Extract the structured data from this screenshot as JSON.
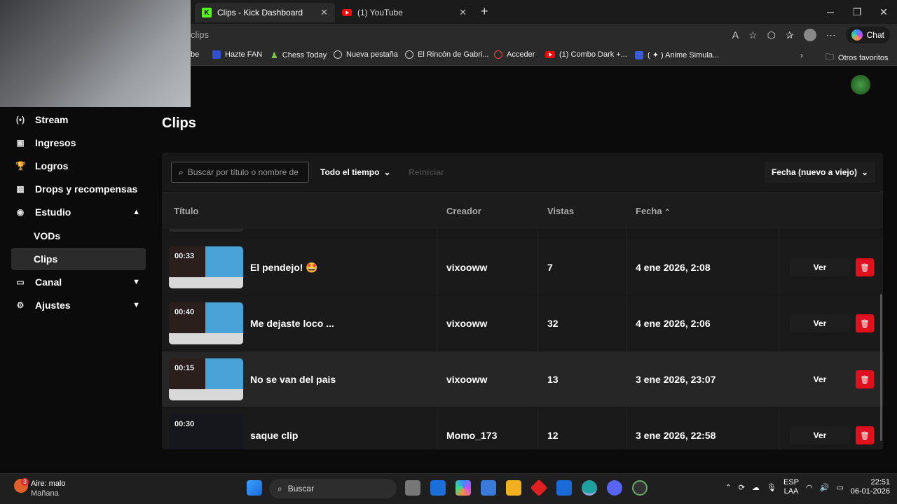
{
  "browser": {
    "tabs": [
      {
        "label": "Clips - Kick Dashboard"
      },
      {
        "label": "(1) YouTube"
      }
    ],
    "url": "clips",
    "chat_label": "Chat",
    "bookmarks": [
      {
        "label": "be"
      },
      {
        "label": "Hazte FAN"
      },
      {
        "label": "Chess Today"
      },
      {
        "label": "Nueva pestaña"
      },
      {
        "label": "El Rincón de Gabri..."
      },
      {
        "label": "Acceder"
      },
      {
        "label": "(1) Combo Dark +..."
      },
      {
        "label": "( ✦ ) Anime Simula..."
      }
    ],
    "other_favorites": "Otros favoritos"
  },
  "sidebar": {
    "items": [
      {
        "label": "Stream",
        "icon": "broadcast-icon"
      },
      {
        "label": "Ingresos",
        "icon": "wallet-icon"
      },
      {
        "label": "Logros",
        "icon": "trophy-icon"
      },
      {
        "label": "Drops y recompensas",
        "icon": "gift-icon"
      },
      {
        "label": "Estudio",
        "icon": "studio-icon"
      },
      {
        "label": "VODs"
      },
      {
        "label": "Clips"
      },
      {
        "label": "Canal",
        "icon": "channel-icon"
      },
      {
        "label": "Ajustes",
        "icon": "gear-icon"
      }
    ]
  },
  "main": {
    "title": "Clips",
    "search_placeholder": "Buscar por título o nombre de",
    "time_filter": "Todo el tiempo",
    "reset": "Reiniciar",
    "sort": "Fecha (nuevo a viejo)",
    "columns": {
      "title": "Título",
      "creator": "Creador",
      "views": "Vistas",
      "date": "Fecha"
    },
    "rows": [
      {
        "duration": "00:33",
        "title": "El pendejo! 🤩",
        "creator": "vixooww",
        "views": "7",
        "date": "4 ene 2026, 2:08",
        "view_label": "Ver"
      },
      {
        "duration": "00:40",
        "title": "Me dejaste loco ...",
        "creator": "vixooww",
        "views": "32",
        "date": "4 ene 2026, 2:06",
        "view_label": "Ver"
      },
      {
        "duration": "00:15",
        "title": "No se van del pais",
        "creator": "vixooww",
        "views": "13",
        "date": "3 ene 2026, 23:07",
        "view_label": "Ver"
      },
      {
        "duration": "00:30",
        "title": "saque clip",
        "creator": "Momo_173",
        "views": "12",
        "date": "3 ene 2026, 22:58",
        "view_label": "Ver"
      }
    ]
  },
  "taskbar": {
    "weather_title": "Aire: malo",
    "weather_sub": "Mañana",
    "weather_badge": "3",
    "search": "Buscar",
    "lang1": "ESP",
    "lang2": "LAA",
    "time": "22:51",
    "date": "06-01-2026"
  },
  "colors": {
    "accent": "#53fc18",
    "danger": "#e0101e"
  }
}
